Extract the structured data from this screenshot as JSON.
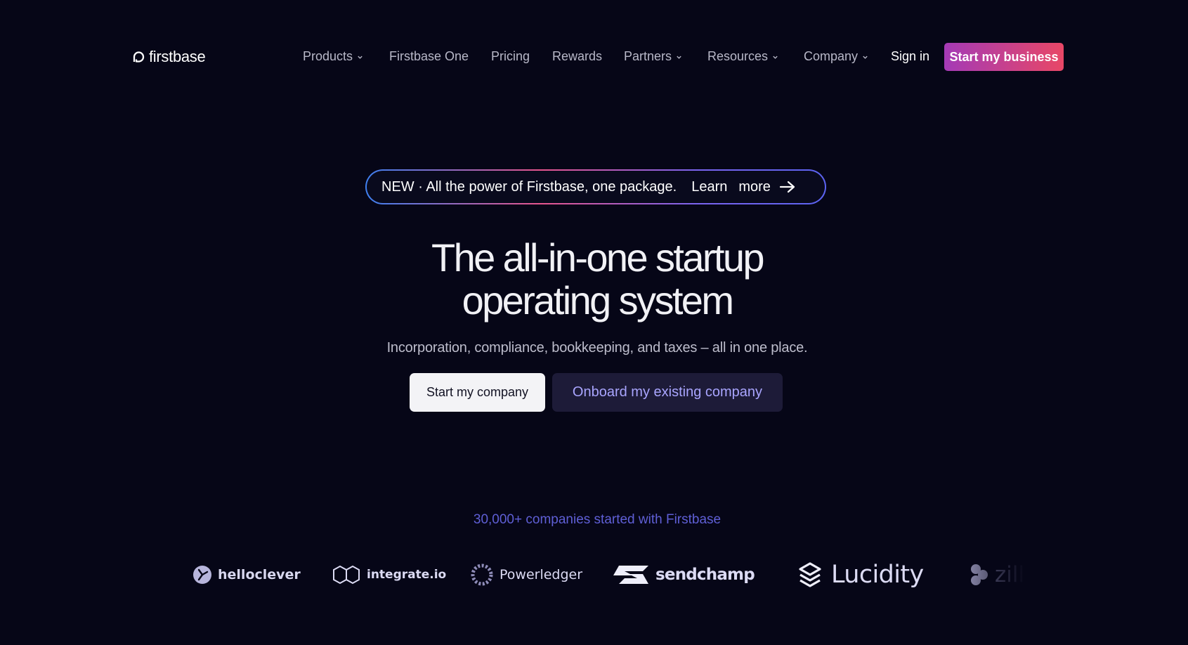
{
  "header": {
    "logo_text": "firstbase",
    "nav": [
      {
        "label": "Products",
        "has_dropdown": true
      },
      {
        "label": "Firstbase One",
        "has_dropdown": false
      },
      {
        "label": "Pricing",
        "has_dropdown": false
      },
      {
        "label": "Rewards",
        "has_dropdown": false
      },
      {
        "label": "Partners",
        "has_dropdown": true
      },
      {
        "label": "Resources",
        "has_dropdown": true
      },
      {
        "label": "Company",
        "has_dropdown": true
      }
    ],
    "sign_in": "Sign in",
    "cta": "Start my business"
  },
  "announcement": {
    "text": "NEW · All the power of Firstbase, one package.",
    "learn": "Learn",
    "more": "more",
    "icon": "arrow-right-icon"
  },
  "hero": {
    "title_line1": "The all-in-one startup",
    "title_line2": "operating system",
    "subtitle": "Incorporation, compliance, bookkeeping, and taxes – all in one place.",
    "primary_button": "Start my company",
    "secondary_button": "Onboard my existing company"
  },
  "social_proof": {
    "text": "30,000+ companies started with Firstbase",
    "logos": [
      {
        "name": "helloclever",
        "icon": "helloclever-logo-icon"
      },
      {
        "name": "integrate.io",
        "icon": "integrate-io-logo-icon"
      },
      {
        "name": "Powerledger",
        "icon": "powerledger-logo-icon"
      },
      {
        "name": "sendchamp",
        "icon": "sendchamp-logo-icon"
      },
      {
        "name": "Lucidity",
        "icon": "lucidity-logo-icon"
      },
      {
        "name": "zilla",
        "icon": "zilla-logo-icon"
      }
    ]
  },
  "colors": {
    "background": "#060617",
    "cta_gradient_start": "#a43ab6",
    "cta_gradient_end": "#e84766",
    "accent_purple": "#a9a5ff",
    "proof_text": "#5f5fd6"
  }
}
